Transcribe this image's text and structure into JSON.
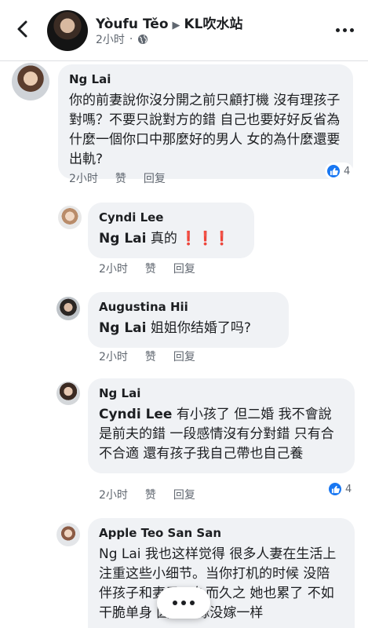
{
  "header": {
    "author": "Yòufu Těo",
    "arrow": "▶",
    "group": "KL吹水站",
    "time": "2小时",
    "back_icon": "back-arrow-icon",
    "more_icon": "more-options-icon"
  },
  "comments": [
    {
      "author": "Ng Lai",
      "text": "你的前妻說你沒分開之前只顧打機 沒有理孩子 對嗎？不要只說對方的錯 自己也要好好反省為什麼一個你口中那麼好的男人 女的為什麼還要出軌?",
      "time": "2小时",
      "like": "赞",
      "reply": "回复",
      "reactions": "4"
    },
    {
      "author": "Cyndi Lee",
      "mention": "Ng Lai",
      "text": " 真的",
      "emoji": "❗❗❗",
      "time": "2小时",
      "like": "赞",
      "reply": "回复"
    },
    {
      "author": "Augustina Hii",
      "mention": "Ng Lai",
      "text": " 姐姐你结婚了吗?",
      "time": "2小时",
      "like": "赞",
      "reply": "回复"
    },
    {
      "author": "Ng Lai",
      "mention": "Cyndi Lee",
      "text": " 有小孩了 但二婚 我不會說是前夫的錯 一段感情沒有分對錯 只有合不合適 還有孩子我自己帶也自己養",
      "time": "2小时",
      "like": "赞",
      "reply": "回复",
      "reactions": "4"
    },
    {
      "author": "Apple Teo San San",
      "mention": "Ng Lai",
      "text": " 我也这样觉得 很多人妻在生活上注重这些小细节。当你打机的时候 没陪伴孩子和妻子。久而久之 她也累了 不如干脆单身 因为有嫁没嫁一样"
    }
  ],
  "colors": {
    "accent": "#1877f2",
    "bubble": "#f0f2f5",
    "meta": "#606770",
    "alert": "#e02020"
  }
}
